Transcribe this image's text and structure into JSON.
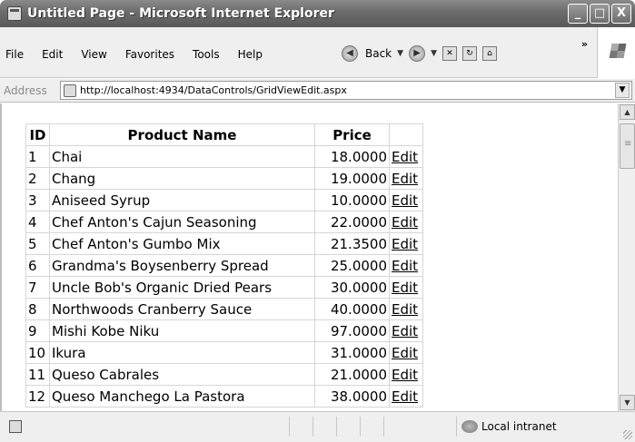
{
  "window": {
    "title": "Untitled Page - Microsoft Internet Explorer",
    "minimize": "_",
    "maximize": "□",
    "close": "X"
  },
  "menu": {
    "items": [
      "File",
      "Edit",
      "View",
      "Favorites",
      "Tools",
      "Help"
    ]
  },
  "toolbar": {
    "back_label": "Back",
    "chevron": "»"
  },
  "address": {
    "label": "Address",
    "url": "http://localhost:4934/DataControls/GridViewEdit.aspx"
  },
  "grid": {
    "headers": [
      "ID",
      "Product Name",
      "Price",
      ""
    ],
    "edit_label": "Edit",
    "rows": [
      {
        "id": "1",
        "name": "Chai",
        "price": "18.0000"
      },
      {
        "id": "2",
        "name": "Chang",
        "price": "19.0000"
      },
      {
        "id": "3",
        "name": "Aniseed Syrup",
        "price": "10.0000"
      },
      {
        "id": "4",
        "name": "Chef Anton's Cajun Seasoning",
        "price": "22.0000"
      },
      {
        "id": "5",
        "name": "Chef Anton's Gumbo Mix",
        "price": "21.3500"
      },
      {
        "id": "6",
        "name": "Grandma's Boysenberry Spread",
        "price": "25.0000"
      },
      {
        "id": "7",
        "name": "Uncle Bob's Organic Dried Pears",
        "price": "30.0000"
      },
      {
        "id": "8",
        "name": "Northwoods Cranberry Sauce",
        "price": "40.0000"
      },
      {
        "id": "9",
        "name": "Mishi Kobe Niku",
        "price": "97.0000"
      },
      {
        "id": "10",
        "name": "Ikura",
        "price": "31.0000"
      },
      {
        "id": "11",
        "name": "Queso Cabrales",
        "price": "21.0000"
      },
      {
        "id": "12",
        "name": "Queso Manchego La Pastora",
        "price": "38.0000"
      }
    ]
  },
  "status": {
    "zone": "Local intranet"
  }
}
